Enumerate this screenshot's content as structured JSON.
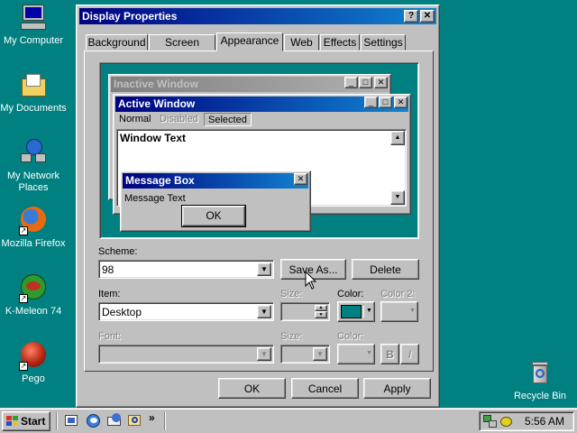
{
  "desktop": {
    "icons": [
      {
        "label": "My Computer",
        "icon": "my-computer-icon"
      },
      {
        "label": "My Documents",
        "icon": "my-documents-icon"
      },
      {
        "label": "My Network Places",
        "icon": "network-places-icon"
      },
      {
        "label": "Mozilla Firefox",
        "icon": "firefox-icon"
      },
      {
        "label": "K-Meleon 74",
        "icon": "k-meleon-icon"
      },
      {
        "label": "Pego",
        "icon": "pego-icon"
      },
      {
        "label": "Recycle Bin",
        "icon": "recycle-bin-icon"
      }
    ]
  },
  "dialog": {
    "title": "Display Properties",
    "help_btn": "?",
    "close_btn": "✕",
    "tabs": [
      "Background",
      "Screen Saver",
      "Appearance",
      "Web",
      "Effects",
      "Settings"
    ],
    "active_tab": "Appearance",
    "preview": {
      "inactive_title": "Inactive Window",
      "active_title": "Active Window",
      "menu_normal": "Normal",
      "menu_disabled": "Disabled",
      "menu_selected": "Selected",
      "window_text": "Window Text",
      "msgbox_title": "Message Box",
      "msgbox_text": "Message Text",
      "msgbox_ok": "OK"
    },
    "scheme_label": "Scheme:",
    "scheme_value": "98",
    "save_as": "Save As...",
    "delete": "Delete",
    "item_label": "Item:",
    "item_value": "Desktop",
    "size_label": "Size:",
    "color_label": "Color:",
    "color2_label": "Color 2:",
    "font_label": "Font:",
    "font_size_label": "Size:",
    "font_color_label": "Color:",
    "bold_btn": "B",
    "italic_btn": "I",
    "desktop_color": "#008080",
    "ok": "OK",
    "cancel": "Cancel",
    "apply": "Apply"
  },
  "taskbar": {
    "start": "Start",
    "quicklaunch_more": "»",
    "clock": "5:56 AM"
  }
}
